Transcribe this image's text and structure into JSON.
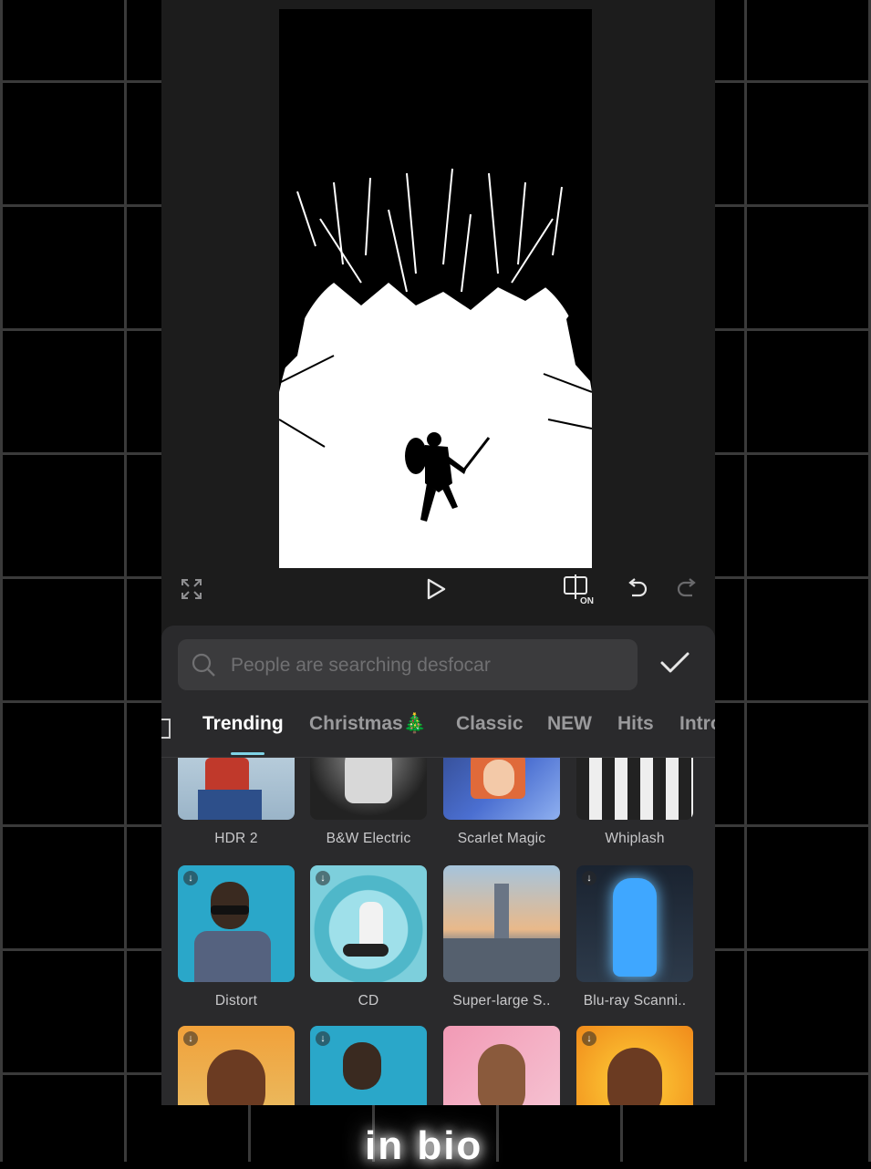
{
  "search": {
    "placeholder": "People are searching desfocar"
  },
  "tabs": [
    {
      "label": "Trending",
      "active": true
    },
    {
      "label": "Christmas🎄",
      "active": false
    },
    {
      "label": "Classic",
      "active": false
    },
    {
      "label": "NEW",
      "active": false
    },
    {
      "label": "Hits",
      "active": false
    },
    {
      "label": "Intro",
      "active": false
    }
  ],
  "effects": {
    "row1": [
      "HDR 2",
      "B&W Electric",
      "Scarlet Magic",
      "Whiplash"
    ],
    "row2": [
      "Distort",
      "CD",
      "Super-large S..",
      "Blu-ray Scanni.."
    ]
  },
  "overlay_text": "in bio",
  "colors": {
    "accent": "#7fd3e6",
    "panel": "#2a2a2c",
    "app_bg": "#1c1c1c"
  },
  "icons": {
    "fullscreen": "fullscreen-icon",
    "play": "play-icon",
    "compare": "compare-on-icon",
    "undo": "undo-icon",
    "redo": "redo-icon",
    "search": "search-icon",
    "confirm": "checkmark-icon",
    "download": "download-icon"
  }
}
